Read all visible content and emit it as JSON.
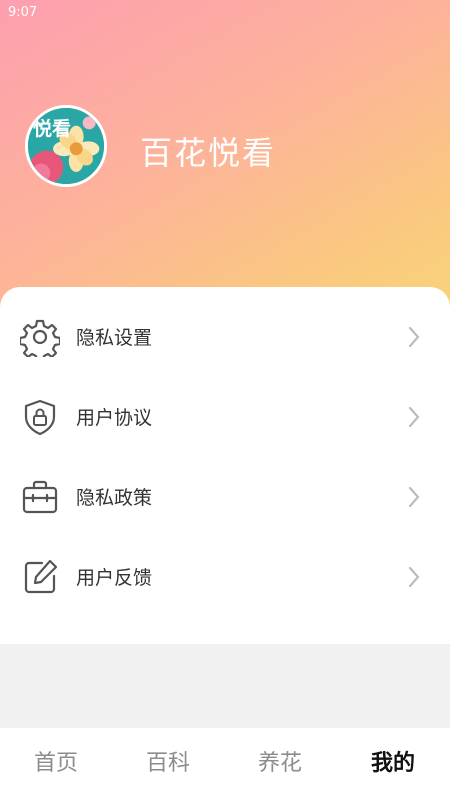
{
  "status_bar": {
    "time": "9:07"
  },
  "header": {
    "app_name": "百花悦看",
    "avatar_text": "悦看"
  },
  "menu": [
    {
      "label": "隐私设置",
      "icon": "gear-icon"
    },
    {
      "label": "用户协议",
      "icon": "shield-lock-icon"
    },
    {
      "label": "隐私政策",
      "icon": "briefcase-icon"
    },
    {
      "label": "用户反馈",
      "icon": "edit-icon"
    }
  ],
  "tabbar": {
    "items": [
      {
        "label": "首页"
      },
      {
        "label": "百科"
      },
      {
        "label": "养花"
      },
      {
        "label": "我的"
      }
    ],
    "active": "我的"
  },
  "colors": {
    "gradient_start": "#fd9fb0",
    "gradient_end": "#f8d47a",
    "icon_stroke": "#555555",
    "chevron": "#bbbbbb"
  }
}
